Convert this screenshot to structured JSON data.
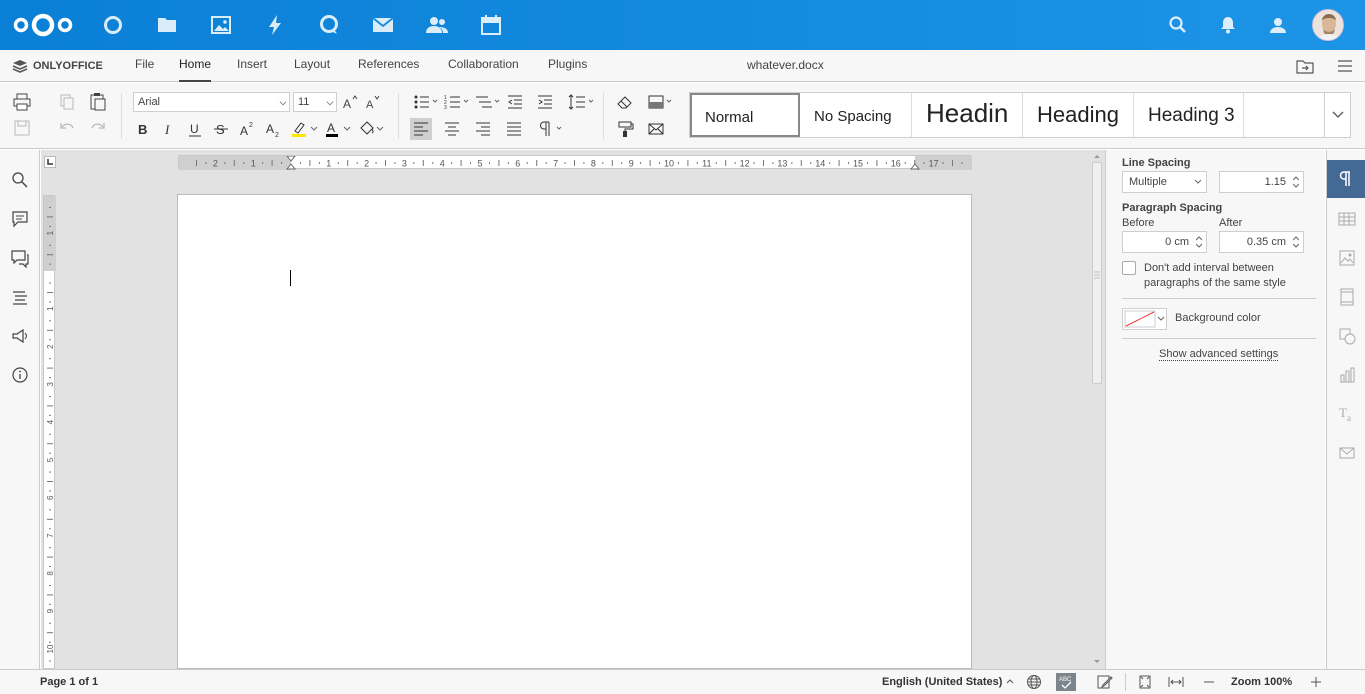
{
  "nextcloud": {
    "apps": [
      "dashboard-icon",
      "files-icon",
      "photos-icon",
      "activity-icon",
      "talk-icon",
      "mail-icon",
      "contacts-icon",
      "calendar-icon"
    ],
    "right_icons": [
      "search-icon",
      "notifications-icon",
      "contacts-menu-icon",
      "avatar"
    ]
  },
  "onlyoffice": {
    "brand": "ONLYOFFICE",
    "tabs": [
      "File",
      "Home",
      "Insert",
      "Layout",
      "References",
      "Collaboration",
      "Plugins"
    ],
    "active_tab": "Home",
    "document_name": "whatever.docx"
  },
  "toolbar": {
    "font_name": "Arial",
    "font_size": "11",
    "styles": [
      "Normal",
      "No Spacing",
      "Headin",
      "Heading",
      "Heading 3"
    ],
    "active_style": "Normal"
  },
  "paragraph_settings": {
    "line_spacing_label": "Line Spacing",
    "line_spacing_type": "Multiple",
    "line_spacing_value": "1.15",
    "paragraph_spacing_label": "Paragraph Spacing",
    "before_label": "Before",
    "before_value": "0 cm",
    "after_label": "After",
    "after_value": "0.35 cm",
    "no_interval_line1": "Don't add interval between",
    "no_interval_line2": "paragraphs of the same style",
    "background_color_label": "Background color",
    "advanced_link": "Show advanced settings"
  },
  "ruler": {
    "h_labels": [
      "2",
      "1",
      "1",
      "2",
      "3",
      "4",
      "5",
      "6",
      "7",
      "8",
      "9",
      "10",
      "11",
      "12",
      "13",
      "14",
      "15",
      "16",
      "17"
    ],
    "v_labels": [
      "1",
      "1",
      "2",
      "3",
      "4",
      "5",
      "6",
      "7",
      "8",
      "9",
      "10"
    ]
  },
  "statusbar": {
    "page_info": "Page 1 of 1",
    "language": "English (United States)",
    "zoom": "Zoom 100%"
  },
  "colors": {
    "nextcloud_blue": "#0a82d8",
    "active_panel": "#446995"
  }
}
